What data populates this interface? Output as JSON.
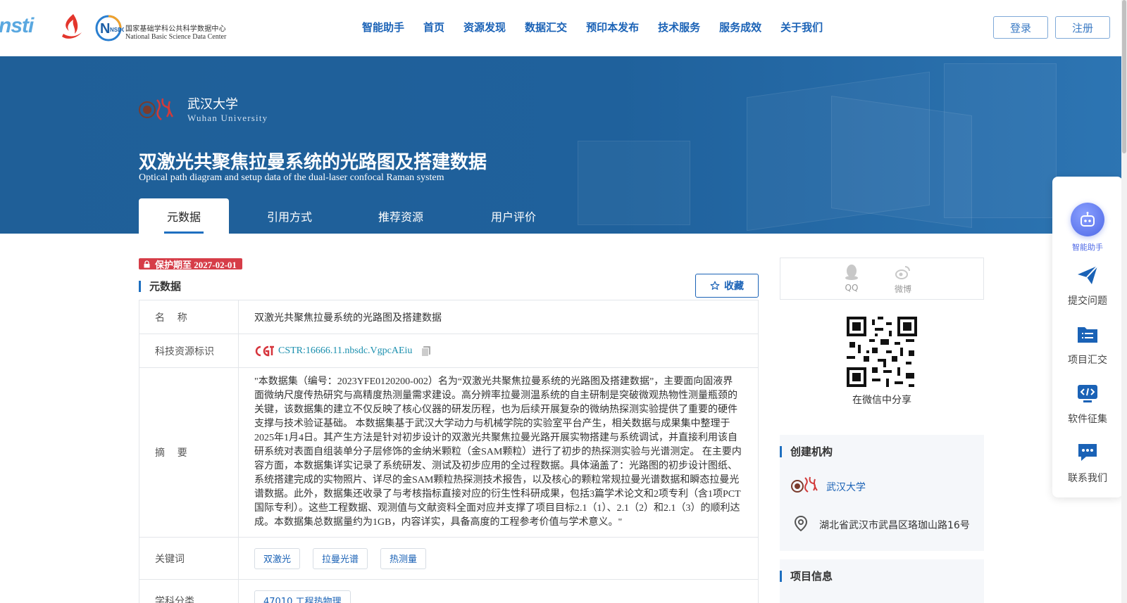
{
  "header": {
    "logo_nsti": "nsti",
    "nsdc_badge": "NSDC",
    "nsdc_cn": "国家基础学科公共科学数据中心",
    "nsdc_en": "National Basic Science Data Center",
    "nav": [
      "智能助手",
      "首页",
      "资源发现",
      "数据汇交",
      "预印本发布",
      "技术服务",
      "服务成效",
      "关于我们"
    ],
    "login_label": "登录",
    "register_label": "注册"
  },
  "banner": {
    "institution_cn": "武汉大学",
    "institution_en": "Wuhan University",
    "title_cn": "双激光共聚焦拉曼系统的光路图及搭建数据",
    "title_en": "Optical path diagram and setup data of the dual-laser confocal Raman system",
    "tabs": [
      "元数据",
      "引用方式",
      "推荐资源",
      "用户评价"
    ],
    "active_tab": "元数据"
  },
  "main": {
    "protect_label": "保护期至 2027-02-01",
    "section_title": "元数据",
    "favorite_label": "收藏",
    "rows": {
      "name_key": "名    称",
      "name_value": "双激光共聚焦拉曼系统的光路图及搭建数据",
      "id_key": "科技资源标识",
      "id_value": "CSTR:16666.11.nbsdc.VgpcAEiu",
      "abstract_key": "摘    要",
      "abstract_value": "\"本数据集（编号：2023YFE0120200-002）名为“双激光共聚焦拉曼系统的光路图及搭建数据”，主要面向固液界面微纳尺度传热研究与高精度热测量需求建设。高分辨率拉曼测温系统的自主研制是突破微观热物性测量瓶颈的关键，该数据集的建立不仅反映了核心仪器的研发历程，也为后续开展复杂的微纳热探测实验提供了重要的硬件支撑与技术验证基础。 本数据集基于武汉大学动力与机械学院的实验室平台产生，相关数据与成果集中整理于2025年1月4日。其产生方法是针对初步设计的双激光共聚焦拉曼光路开展实物搭建与系统调试，并直接利用该自研系统对表面自组装单分子层修饰的金纳米颗粒（金SAM颗粒）进行了初步的热探测实验与光谱测定。 在主要内容方面，本数据集详实记录了系统研发、测试及初步应用的全过程数据。具体涵盖了：光路图的初步设计图纸、系统搭建完成的实物照片、详尽的金SAM颗粒热探测技术报告，以及核心的颗粒常规拉曼光谱数据和瞬态拉曼光谱数据。此外，数据集还收录了与考核指标直接对应的衍生性科研成果，包括3篇学术论文和2项专利（含1项PCT国际专利）。这些工程数据、观测值与文献资料全面对应并支撑了项目目标2.1（1）、2.1（2）和2.1（3）的顺利达成。本数据集总数据量约为1GB，内容详实，具备高度的工程参考价值与学术意义。\"",
      "keywords_key": "关键词",
      "keywords": [
        "双激光",
        "拉曼光谱",
        "热测量"
      ],
      "subject_key": "学科分类",
      "subject_value": "47010 工程热物理"
    }
  },
  "side": {
    "share_qq": "QQ",
    "share_weibo": "微博",
    "qr_caption": "在微信中分享",
    "org_section": "创建机构",
    "org_name": "武汉大学",
    "org_address": "湖北省武汉市武昌区珞珈山路16号",
    "project_section": "项目信息"
  },
  "float_bar": {
    "assistant_label": "智能助手",
    "items": [
      "提交问题",
      "项目汇交",
      "软件征集",
      "联系我们"
    ]
  },
  "colors": {
    "brand_blue": "#1a62b6",
    "banner_blue": "#1f5f98",
    "protect_red": "#d63d48"
  }
}
